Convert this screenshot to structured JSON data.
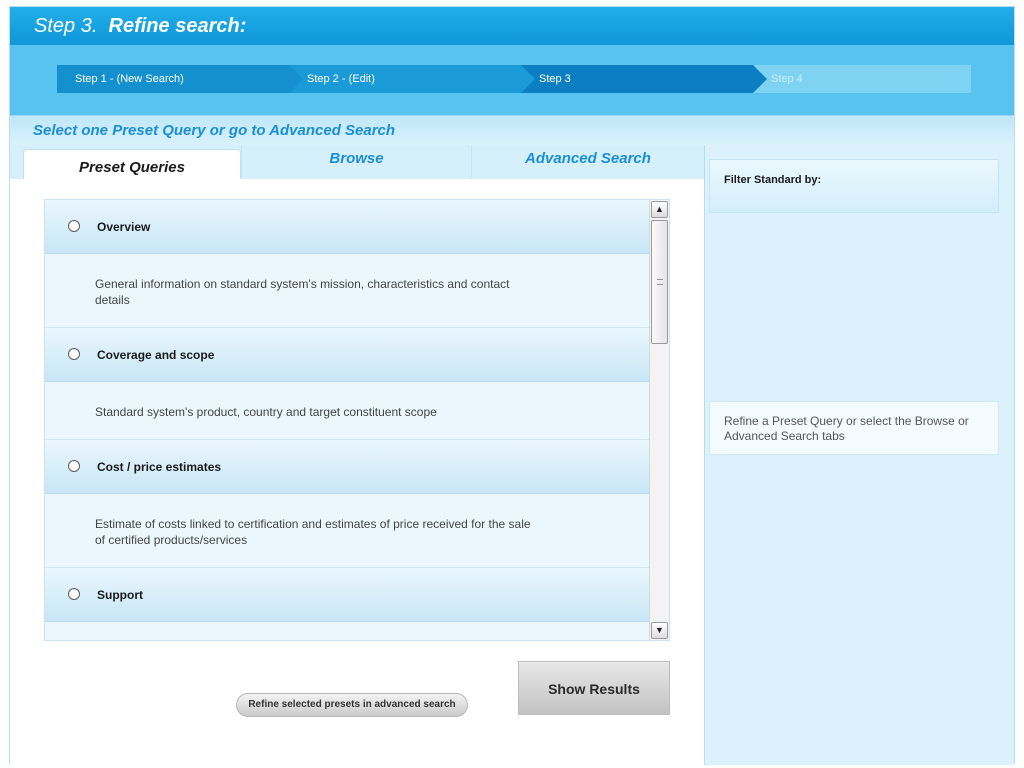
{
  "header": {
    "step_prefix": "Step 3.",
    "step_title": "Refine search:"
  },
  "steps": [
    {
      "label": "Step 1 - (New Search)"
    },
    {
      "label": "Step 2 - (Edit)"
    },
    {
      "label": "Step 3"
    },
    {
      "label": "Step 4"
    }
  ],
  "subhead": "Select one Preset Query or go to Advanced Search",
  "tabs": [
    {
      "label": "Preset Queries",
      "active": true
    },
    {
      "label": "Browse",
      "active": false
    },
    {
      "label": "Advanced Search",
      "active": false
    }
  ],
  "presets": [
    {
      "title": "Overview",
      "description": "General information on standard system's mission, characteristics and contact details"
    },
    {
      "title": "Coverage and scope",
      "description": "Standard system's product, country and target constituent scope"
    },
    {
      "title": "Cost / price estimates",
      "description": "Estimate of costs linked to certification and estimates of price received for the sale of certified products/services"
    },
    {
      "title": "Support",
      "description": ""
    }
  ],
  "buttons": {
    "refine": "Refine selected presets in advanced search",
    "show_results": "Show Results"
  },
  "sidebar": {
    "filter_label": "Filter Standard by:",
    "hint": "Refine a Preset Query or select the Browse or Advanced Search tabs"
  },
  "colors": {
    "header_blue": "#0f97da",
    "accent_text": "#1b8fd2",
    "panel_bg": "#dbf2fc"
  }
}
